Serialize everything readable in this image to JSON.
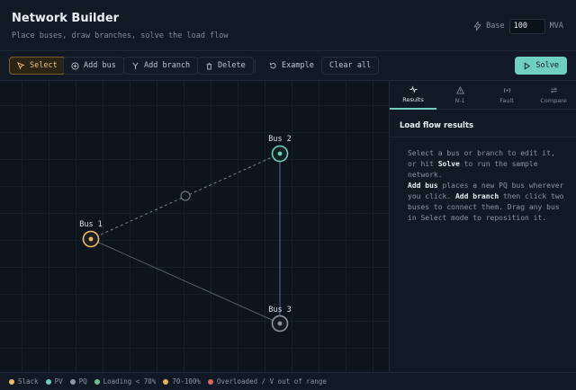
{
  "header": {
    "title": "Network Builder",
    "subtitle": "Place buses, draw branches, solve the load flow",
    "base_label": "Base",
    "base_value": "100",
    "base_unit": "MVA"
  },
  "toolbar": {
    "select": "Select",
    "add_bus": "Add bus",
    "add_branch": "Add branch",
    "delete": "Delete",
    "example": "Example",
    "clear_all": "Clear all",
    "solve": "Solve"
  },
  "network": {
    "buses": [
      {
        "label": "Bus 1",
        "type": "slack"
      },
      {
        "label": "Bus 2",
        "type": "pv"
      },
      {
        "label": "Bus 3",
        "type": "pq"
      }
    ]
  },
  "tabs": [
    {
      "label": "Results",
      "icon": "pulse-icon",
      "active": true
    },
    {
      "label": "N-1",
      "icon": "warning-icon",
      "active": false
    },
    {
      "label": "Fault",
      "icon": "radio-icon",
      "active": false
    },
    {
      "label": "Compare",
      "icon": "swap-icon",
      "active": false
    }
  ],
  "panel": {
    "heading": "Load flow results",
    "help1_a": "Select a bus or branch to edit it, or hit ",
    "help1_b": "Solve",
    "help1_c": " to run the sample network.",
    "help2_a": "Add bus",
    "help2_b": " places a new PQ bus wherever you click. ",
    "help2_c": "Add branch",
    "help2_d": " then click two buses to connect them. Drag any bus in Select mode to reposition it."
  },
  "legend": [
    {
      "label": "Slack",
      "color": "#f0b965"
    },
    {
      "label": "PV",
      "color": "#6fd0c0"
    },
    {
      "label": "PQ",
      "color": "#8d98a5"
    },
    {
      "label": "Loading < 70%",
      "color": "#67c48a"
    },
    {
      "label": "70-100%",
      "color": "#e8b04f"
    },
    {
      "label": "Overloaded / V out of range",
      "color": "#e0645f"
    }
  ],
  "colors": {
    "accent": "#6fd0c0",
    "slack": "#f0b965",
    "pq": "#8d98a5"
  }
}
